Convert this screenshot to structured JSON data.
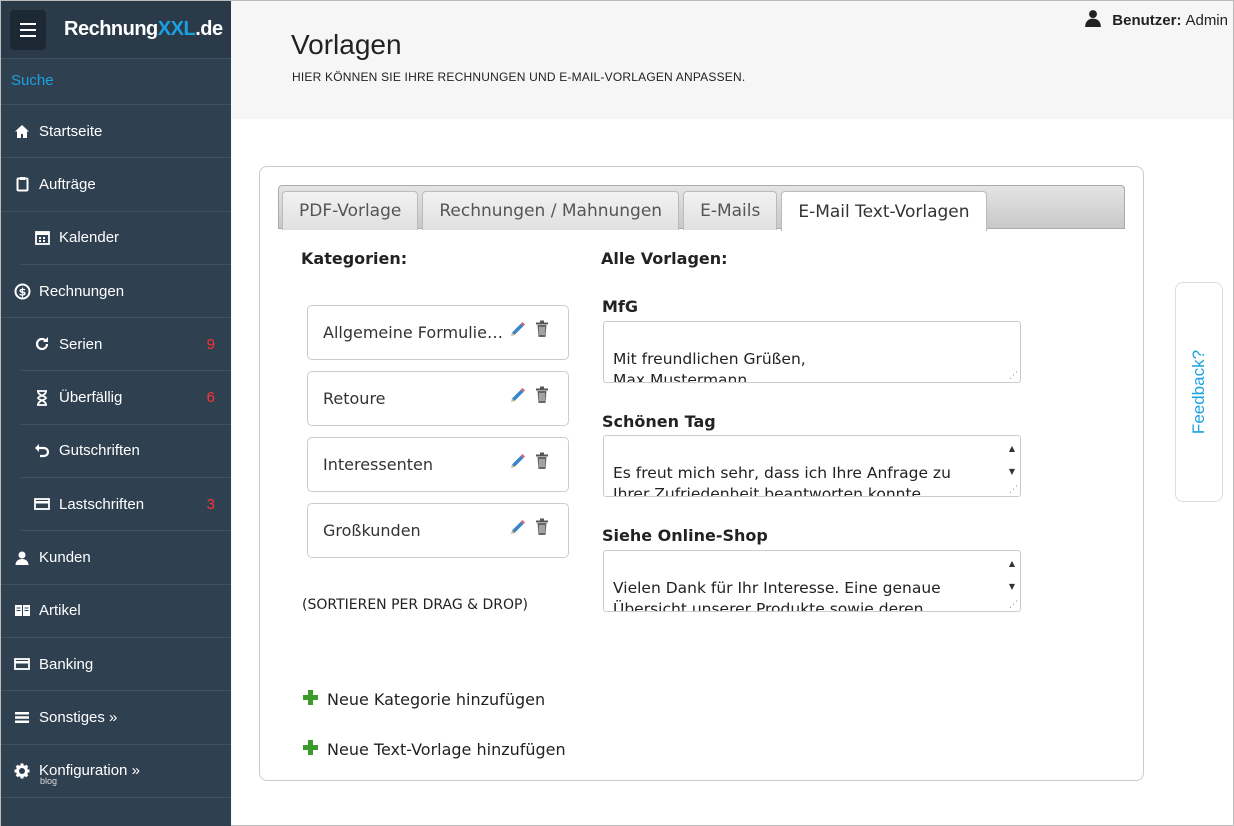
{
  "app": {
    "brand_prefix": "Rechnung",
    "brand_accent": "XXL",
    "brand_suffix": ".de"
  },
  "sidebar": {
    "search_label": "Suche",
    "items": [
      {
        "label": "Startseite",
        "icon": "home-icon",
        "badge": ""
      },
      {
        "label": "Aufträge",
        "icon": "clipboard-icon",
        "badge": ""
      },
      {
        "label": "Kalender",
        "icon": "calendar-icon",
        "badge": ""
      },
      {
        "label": "Rechnungen",
        "icon": "dollar-circle-icon",
        "badge": ""
      },
      {
        "label": "Serien",
        "icon": "refresh-icon",
        "badge": "9"
      },
      {
        "label": "Überfällig",
        "icon": "hourglass-icon",
        "badge": "6"
      },
      {
        "label": "Gutschriften",
        "icon": "undo-icon",
        "badge": ""
      },
      {
        "label": "Lastschriften",
        "icon": "credit-card-icon",
        "badge": "3"
      },
      {
        "label": "Kunden",
        "icon": "user-icon",
        "badge": ""
      },
      {
        "label": "Artikel",
        "icon": "book-icon",
        "badge": ""
      },
      {
        "label": "Banking",
        "icon": "credit-card-icon",
        "badge": ""
      },
      {
        "label": "Sonstiges »",
        "icon": "list-icon",
        "badge": ""
      },
      {
        "label": "Konfiguration »",
        "icon": "gear-icon",
        "badge": ""
      }
    ],
    "blog_label": "blog"
  },
  "header": {
    "title": "Vorlagen",
    "subtitle": "HIER KÖNNEN SIE IHRE RECHNUNGEN UND E-MAIL-VORLAGEN ANPASSEN.",
    "user_label": "Benutzer:",
    "user_name": "Admin"
  },
  "tabs": [
    {
      "label": "PDF-Vorlage",
      "active": false
    },
    {
      "label": "Rechnungen / Mahnungen",
      "active": false
    },
    {
      "label": "E-Mails",
      "active": false
    },
    {
      "label": "E-Mail Text-Vorlagen",
      "active": true
    }
  ],
  "categories": {
    "heading": "Kategorien:",
    "items": [
      "Allgemeine Formulierungen",
      "Retoure",
      "Interessenten",
      "Großkunden"
    ],
    "sort_hint": "(SORTIEREN PER DRAG & DROP)",
    "add_category": "Neue Kategorie hinzufügen",
    "add_template": "Neue Text-Vorlage hinzufügen"
  },
  "templates": {
    "heading": "Alle Vorlagen:",
    "items": [
      {
        "title": "MfG",
        "text": "Mit freundlichen Grüßen,\nMax Mustermann"
      },
      {
        "title": "Schönen Tag",
        "text": "Es freut mich sehr, dass ich Ihre Anfrage zu\nIhrer Zufriedenheit beantworten konnte.\nWeiterhin wünsche ich Ihnen noch einen schönen Tag."
      },
      {
        "title": "Siehe Online-Shop",
        "text": "Vielen Dank für Ihr Interesse. Eine genaue\nÜbersicht unserer Produkte sowie deren\nSpezifikationen finden Sie in unserem Online-Shop."
      }
    ]
  },
  "feedback_label": "Feedback?",
  "colors": {
    "sidebar_bg": "#2f4050",
    "accent": "#1ba1e2",
    "badge": "#ff3333",
    "plus_green": "#3a9a2a"
  }
}
